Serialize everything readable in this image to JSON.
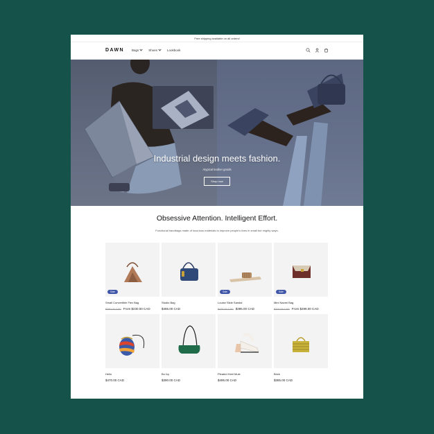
{
  "announcement": "Free shipping available on all orders!",
  "header": {
    "logo": "DAWN",
    "nav": [
      {
        "label": "Bags",
        "has_dropdown": true
      },
      {
        "label": "Shoes",
        "has_dropdown": true
      },
      {
        "label": "Lookbook",
        "has_dropdown": false
      }
    ],
    "icons": [
      "search-icon",
      "account-icon",
      "cart-icon"
    ]
  },
  "hero": {
    "heading": "Industrial design meets fashion.",
    "subheading": "Atypical leather goods",
    "button_label": "Shop now"
  },
  "intro": {
    "title": "Obsessive Attention. Intelligent Effort.",
    "text": "Functional handbags made of luxurious materials to improve people's lives in small but mighty ways."
  },
  "colors": {
    "background": "#14524a",
    "sale_badge": "#3f55a8",
    "hero": "#5e6882"
  },
  "products": [
    {
      "title": "Small Convertible Flex Bag",
      "price": "From $230.00 CAD",
      "compare_price": "$250.00 CAD",
      "sale": true,
      "sale_label": "Sale",
      "icon": "tan-bag-icon"
    },
    {
      "title": "Studio Bag",
      "price": "$465.00 CAD",
      "compare_price": "",
      "sale": false,
      "sale_label": "",
      "icon": "navy-bag-icon"
    },
    {
      "title": "Louise Slide Sandal",
      "price": "$395.00 CAD",
      "compare_price": "$425.00 CAD",
      "sale": true,
      "sale_label": "Sale",
      "icon": "sandal-icon"
    },
    {
      "title": "Mini Naomi Bag",
      "price": "From $299.00 CAD",
      "compare_price": "$320.00 CAD",
      "sale": true,
      "sale_label": "Sale",
      "icon": "mini-bag-icon"
    },
    {
      "title": "Hello",
      "price": "$470.00 CAD",
      "compare_price": "",
      "sale": false,
      "sale_label": "",
      "icon": "striped-bag-icon"
    },
    {
      "title": "Bo Ivy",
      "price": "$390.00 CAD",
      "compare_price": "",
      "sale": false,
      "sale_label": "",
      "icon": "green-bag-icon"
    },
    {
      "title": "Pleated Heel Mule",
      "price": "$495.00 CAD",
      "compare_price": "",
      "sale": false,
      "sale_label": "",
      "icon": "mule-icon"
    },
    {
      "title": "Brick",
      "price": "$385.00 CAD",
      "compare_price": "",
      "sale": false,
      "sale_label": "",
      "icon": "yellow-bag-icon"
    }
  ]
}
